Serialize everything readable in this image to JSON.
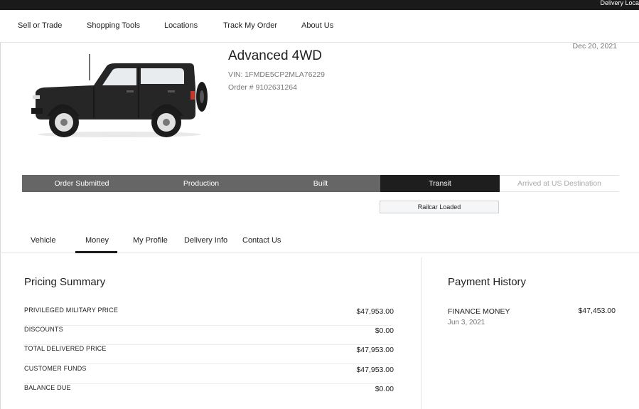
{
  "topbar": {
    "delivery_text": "Delivery Loca"
  },
  "nav": {
    "items": [
      "Sell or Trade",
      "Shopping Tools",
      "Locations",
      "Track My Order",
      "About Us"
    ]
  },
  "vehicle": {
    "title": "Advanced 4WD",
    "vin": "VIN: 1FMDE5CP2MLA76229",
    "order": "Order # 9102631264",
    "date": "Dec 20, 2021",
    "color": "#262626"
  },
  "progress": {
    "steps": [
      "Order Submitted",
      "Production",
      "Built",
      "Transit",
      "Arrived at US Destination"
    ],
    "current_index": 3,
    "substatus": "Railcar Loaded"
  },
  "tabs": {
    "items": [
      "Vehicle",
      "Money",
      "My Profile",
      "Delivery Info",
      "Contact Us"
    ],
    "active": "Money"
  },
  "pricing": {
    "title": "Pricing Summary",
    "rows": [
      {
        "label": "PRIVILEGED MILITARY PRICE",
        "value": "$47,953.00"
      },
      {
        "label": "DISCOUNTS",
        "value": "$0.00"
      },
      {
        "label": "TOTAL DELIVERED PRICE",
        "value": "$47,953.00"
      },
      {
        "label": "CUSTOMER FUNDS",
        "value": "$47,953.00"
      },
      {
        "label": "BALANCE DUE",
        "value": "$0.00"
      }
    ]
  },
  "payment": {
    "title": "Payment History",
    "items": [
      {
        "label": "FINANCE MONEY",
        "date": "Jun 3, 2021",
        "amount": "$47,453.00"
      }
    ]
  },
  "colors": {
    "topbar": "#1a1a1a",
    "step_done": "#666666",
    "step_current": "#1e1e1e",
    "step_pending_text": "#aaaaaa"
  }
}
